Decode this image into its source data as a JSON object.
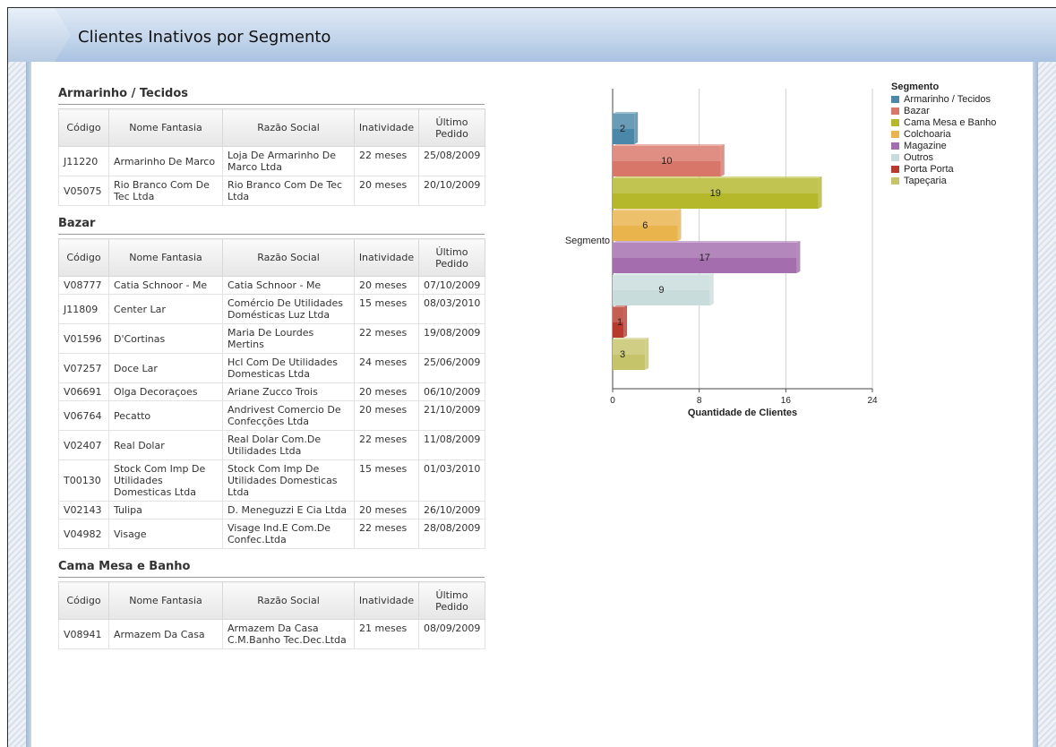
{
  "page": {
    "title": "Clientes Inativos por Segmento"
  },
  "table_headers": {
    "codigo": "Código",
    "nome": "Nome Fantasia",
    "razao": "Razão Social",
    "inatividade": "Inatividade",
    "ultimo": "Último Pedido"
  },
  "sections": [
    {
      "title": "Armarinho / Tecidos",
      "rows": [
        {
          "codigo": "J11220",
          "nome": "Armarinho De Marco",
          "razao": "Loja De Armarinho De Marco Ltda",
          "inatividade": "22 meses",
          "ultimo": "25/08/2009"
        },
        {
          "codigo": "V05075",
          "nome": "Rio Branco Com De Tec Ltda",
          "razao": "Rio Branco Com De Tec Ltda",
          "inatividade": "20 meses",
          "ultimo": "20/10/2009"
        }
      ]
    },
    {
      "title": "Bazar",
      "rows": [
        {
          "codigo": "V08777",
          "nome": "Catia Schnoor - Me",
          "razao": "Catia Schnoor - Me",
          "inatividade": "20 meses",
          "ultimo": "07/10/2009"
        },
        {
          "codigo": "J11809",
          "nome": "Center Lar",
          "razao": "Comércio De Utilidades Domésticas Luz Ltda",
          "inatividade": "15 meses",
          "ultimo": "08/03/2010"
        },
        {
          "codigo": "V01596",
          "nome": "D'Cortinas",
          "razao": "Maria De Lourdes Mertins",
          "inatividade": "22 meses",
          "ultimo": "19/08/2009"
        },
        {
          "codigo": "V07257",
          "nome": "Doce Lar",
          "razao": "Hcl Com De Utilidades Domesticas Ltda",
          "inatividade": "24 meses",
          "ultimo": "25/06/2009"
        },
        {
          "codigo": "V06691",
          "nome": "Olga Decoraçoes",
          "razao": "Ariane Zucco Trois",
          "inatividade": "20 meses",
          "ultimo": "06/10/2009"
        },
        {
          "codigo": "V06764",
          "nome": "Pecatto",
          "razao": "Andrivest Comercio De Confecções Ltda",
          "inatividade": "20 meses",
          "ultimo": "21/10/2009"
        },
        {
          "codigo": "V02407",
          "nome": "Real Dolar",
          "razao": "Real Dolar Com.De Utilidades Ltda",
          "inatividade": "22 meses",
          "ultimo": "11/08/2009"
        },
        {
          "codigo": "T00130",
          "nome": "Stock Com Imp De Utilidades Domesticas Ltda",
          "razao": "Stock Com Imp De Utilidades Domesticas Ltda",
          "inatividade": "15 meses",
          "ultimo": "01/03/2010"
        },
        {
          "codigo": "V02143",
          "nome": "Tulipa",
          "razao": "D. Meneguzzi E Cia Ltda",
          "inatividade": "20 meses",
          "ultimo": "26/10/2009"
        },
        {
          "codigo": "V04982",
          "nome": "Visage",
          "razao": "Visage Ind.E Com.De Confec.Ltda",
          "inatividade": "22 meses",
          "ultimo": "28/08/2009"
        }
      ]
    },
    {
      "title": "Cama Mesa e Banho",
      "rows": [
        {
          "codigo": "V08941",
          "nome": "Armazem Da Casa",
          "razao": "Armazem Da Casa C.M.Banho Tec.Dec.Ltda",
          "inatividade": "21 meses",
          "ultimo": "08/09/2009"
        }
      ]
    }
  ],
  "chart_data": {
    "type": "bar",
    "orientation": "horizontal",
    "ylabel": "Segmento",
    "xlabel": "Quantidade de Clientes",
    "xlim": [
      0,
      24
    ],
    "xticks": [
      "0",
      "8",
      "16",
      "24"
    ],
    "grid": true,
    "legend_title": "Segmento",
    "legend_position": "right",
    "series": [
      {
        "name": "Armarinho / Tecidos",
        "value": 2,
        "color": "#4a87a8"
      },
      {
        "name": "Bazar",
        "value": 10,
        "color": "#d9766a"
      },
      {
        "name": "Cama Mesa e Banho",
        "value": 19,
        "color": "#b4b82a"
      },
      {
        "name": "Colchoaria",
        "value": 6,
        "color": "#e9b44c"
      },
      {
        "name": "Magazine",
        "value": 17,
        "color": "#a46dae"
      },
      {
        "name": "Outros",
        "value": 9,
        "color": "#c9dcdc"
      },
      {
        "name": "Porta Porta",
        "value": 1,
        "color": "#b73a2c"
      },
      {
        "name": "Tapeçaria",
        "value": 3,
        "color": "#c6c46a"
      }
    ]
  }
}
